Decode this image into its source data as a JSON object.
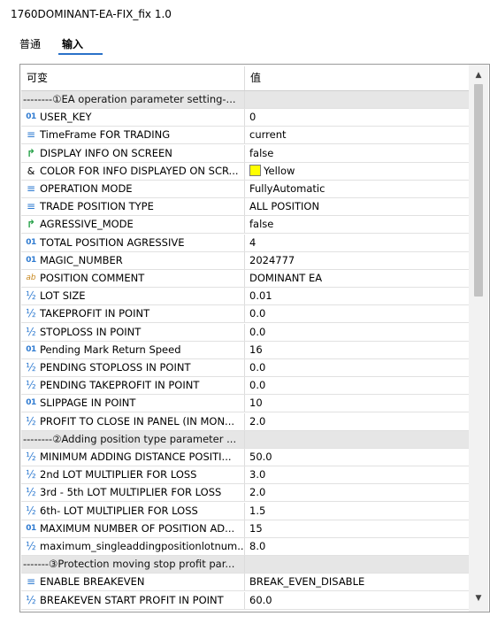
{
  "window": {
    "title": "1760DOMINANT-EA-FIX_fix 1.0"
  },
  "tabs": [
    {
      "label": "普通"
    },
    {
      "label": "输入"
    }
  ],
  "table": {
    "columns": [
      "可变",
      "值"
    ],
    "rows": [
      {
        "type": "section",
        "name": "--------①EA operation parameter setting-...",
        "value": ""
      },
      {
        "type": "param",
        "icon": "int-icon",
        "name": "USER_KEY",
        "value": "0"
      },
      {
        "type": "param",
        "icon": "enum-icon",
        "name": "TimeFrame FOR TRADING",
        "value": "current"
      },
      {
        "type": "param",
        "icon": "bool-icon",
        "name": "DISPLAY INFO ON SCREEN",
        "value": "false"
      },
      {
        "type": "param",
        "icon": "color-icon",
        "name": "COLOR FOR INFO DISPLAYED ON SCR...",
        "value": "Yellow",
        "swatch": "#FFFF00"
      },
      {
        "type": "param",
        "icon": "enum-icon",
        "name": "OPERATION MODE",
        "value": "FullyAutomatic"
      },
      {
        "type": "param",
        "icon": "enum-icon",
        "name": "TRADE POSITION TYPE",
        "value": "ALL POSITION"
      },
      {
        "type": "param",
        "icon": "bool-icon",
        "name": "AGRESSIVE_MODE",
        "value": "false"
      },
      {
        "type": "param",
        "icon": "int-icon",
        "name": "TOTAL POSITION AGRESSIVE",
        "value": "4"
      },
      {
        "type": "param",
        "icon": "int-icon",
        "name": "MAGIC_NUMBER",
        "value": "2024777"
      },
      {
        "type": "param",
        "icon": "string-icon",
        "name": "POSITION COMMENT",
        "value": "DOMINANT EA"
      },
      {
        "type": "param",
        "icon": "double-icon",
        "name": "LOT SIZE",
        "value": "0.01"
      },
      {
        "type": "param",
        "icon": "double-icon",
        "name": "TAKEPROFIT IN POINT",
        "value": "0.0"
      },
      {
        "type": "param",
        "icon": "double-icon",
        "name": "STOPLOSS IN POINT",
        "value": "0.0"
      },
      {
        "type": "param",
        "icon": "int-icon",
        "name": "Pending Mark Return Speed",
        "value": "16"
      },
      {
        "type": "param",
        "icon": "double-icon",
        "name": "PENDING STOPLOSS IN POINT",
        "value": "0.0"
      },
      {
        "type": "param",
        "icon": "double-icon",
        "name": "PENDING TAKEPROFIT IN POINT",
        "value": "0.0"
      },
      {
        "type": "param",
        "icon": "int-icon",
        "name": "SLIPPAGE IN POINT",
        "value": "10"
      },
      {
        "type": "param",
        "icon": "double-icon",
        "name": "PROFIT TO CLOSE IN PANEL (IN MON...",
        "value": "2.0"
      },
      {
        "type": "section",
        "name": "--------②Adding position type parameter ...",
        "value": ""
      },
      {
        "type": "param",
        "icon": "double-icon",
        "name": "MINIMUM ADDING DISTANCE POSITI...",
        "value": "50.0"
      },
      {
        "type": "param",
        "icon": "double-icon",
        "name": "2nd LOT MULTIPLIER FOR  LOSS",
        "value": "3.0"
      },
      {
        "type": "param",
        "icon": "double-icon",
        "name": "3rd - 5th LOT MULTIPLIER FOR  LOSS",
        "value": "2.0"
      },
      {
        "type": "param",
        "icon": "double-icon",
        "name": "6th- LOT MULTIPLIER FOR  LOSS",
        "value": "1.5"
      },
      {
        "type": "param",
        "icon": "int-icon",
        "name": "MAXIMUM NUMBER OF POSITION AD...",
        "value": "15"
      },
      {
        "type": "param",
        "icon": "double-icon",
        "name": "maximum_singleaddingpositionlotnum...",
        "value": "8.0"
      },
      {
        "type": "section",
        "name": "-------③Protection moving stop profit par...",
        "value": ""
      },
      {
        "type": "param",
        "icon": "enum-icon",
        "name": "ENABLE BREAKEVEN",
        "value": "BREAK_EVEN_DISABLE"
      },
      {
        "type": "param",
        "icon": "double-icon",
        "name": "BREAKEVEN START PROFIT IN POINT",
        "value": "60.0"
      }
    ]
  },
  "icons": {
    "int-icon": "01",
    "double-icon": "½",
    "enum-icon": "≡",
    "bool-icon": "↱",
    "color-icon": "&",
    "string-icon": "ab"
  },
  "scrollbar": {
    "up": "▲",
    "down": "▼"
  }
}
